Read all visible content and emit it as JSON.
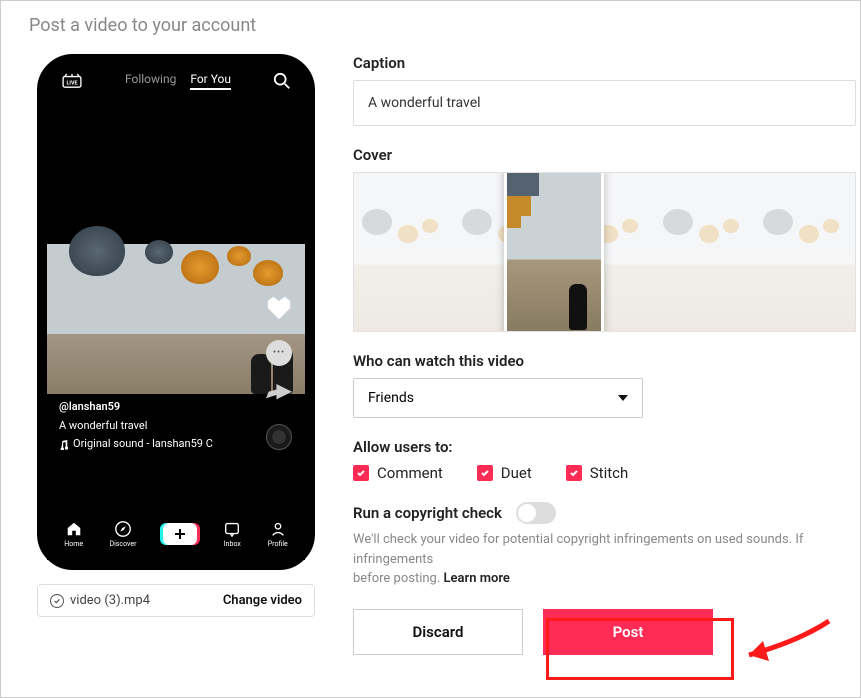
{
  "page_title": "Post a video to your account",
  "phone": {
    "tabs": {
      "following": "Following",
      "foryou": "For You"
    },
    "user": "@lanshan59",
    "caption": "A wonderful travel",
    "music": "Original sound - lanshan59 C",
    "nav": {
      "home": "Home",
      "discover": "Discover",
      "inbox": "Inbox",
      "profile": "Profile"
    }
  },
  "file": {
    "name": "video (3).mp4",
    "change": "Change video"
  },
  "caption": {
    "label": "Caption",
    "value": "A wonderful travel"
  },
  "cover": {
    "label": "Cover"
  },
  "visibility": {
    "label": "Who can watch this video",
    "value": "Friends"
  },
  "allow": {
    "label": "Allow users to:",
    "comment": "Comment",
    "duet": "Duet",
    "stitch": "Stitch"
  },
  "copyright": {
    "label": "Run a copyright check",
    "helper": "We'll check your video for potential copyright infringements on used sounds. If infringements",
    "helper2": "before posting.",
    "learn": "Learn more"
  },
  "buttons": {
    "discard": "Discard",
    "post": "Post"
  }
}
